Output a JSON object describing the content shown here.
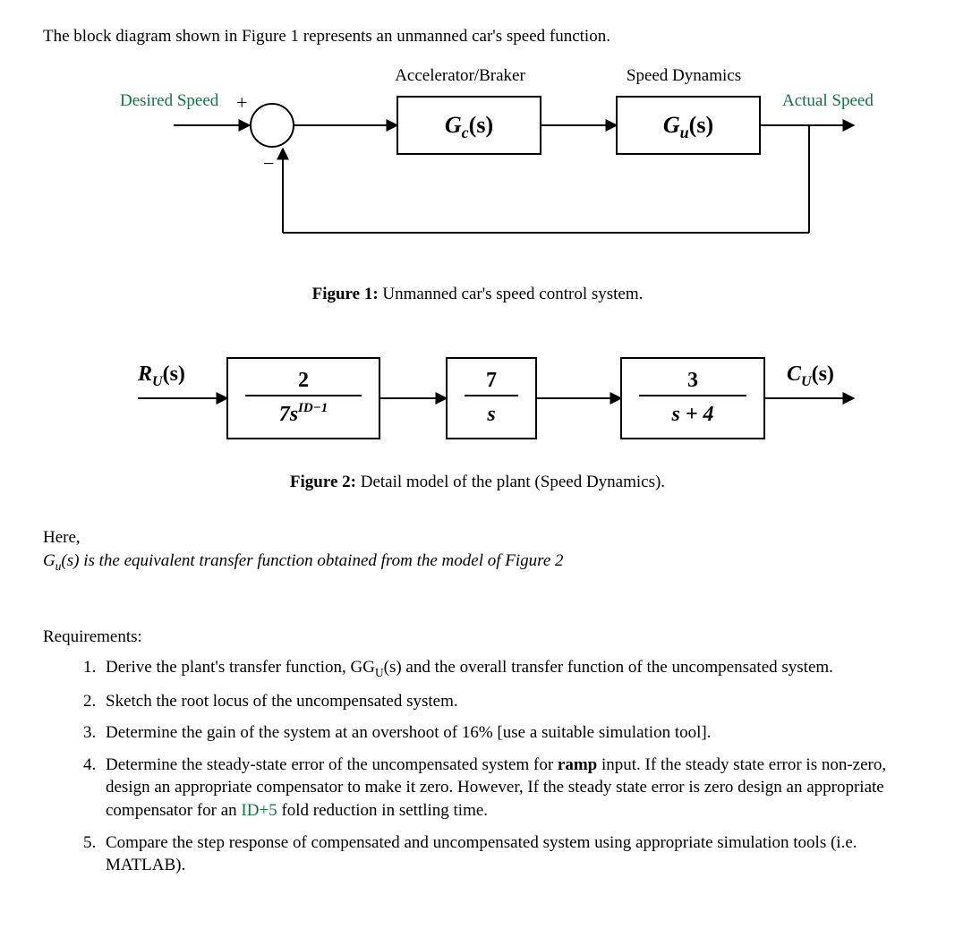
{
  "intro": "The block diagram shown in Figure 1 represents an unmanned car's speed function.",
  "fig1": {
    "labels": {
      "top_left": "Accelerator/Braker",
      "top_right": "Speed Dynamics",
      "input": "Desired Speed",
      "output": "Actual Speed",
      "plus": "+",
      "minus": "−",
      "block1": "G",
      "block1_sub": "c",
      "block1_arg": "(s)",
      "block2": "G",
      "block2_sub": "u",
      "block2_arg": "(s)"
    },
    "caption_bold": "Figure 1:",
    "caption_rest": " Unmanned car's speed control system."
  },
  "fig2": {
    "input_sym": "R",
    "input_sub": "U",
    "input_arg": "(s)",
    "output_sym": "C",
    "output_sub": "U",
    "output_arg": "(s)",
    "block1_num": "2",
    "block1_den_a": "7s",
    "block1_den_sup": "ID−1",
    "block2_num": "7",
    "block2_den": "s",
    "block3_num": "3",
    "block3_den": "s + 4",
    "caption_bold": "Figure 2:",
    "caption_rest": " Detail model of the plant (Speed Dynamics)."
  },
  "here": "Here,",
  "gu_desc_a": "G",
  "gu_desc_sub": "u",
  "gu_desc_b": "(s) is the equivalent transfer function obtained from the model of Figure 2",
  "req_title": "Requirements:",
  "req": [
    {
      "a": "Derive the plant's transfer function, G",
      "sub": "U",
      "b": "(s) and the overall transfer function of the uncompensated system."
    },
    {
      "a": "Sketch the root locus of the uncompensated system."
    },
    {
      "a": "Determine the gain of the system at an overshoot of 16% [use a suitable simulation tool]."
    },
    {
      "a": "Determine the steady-state error of the uncompensated system for ",
      "bold": "ramp",
      "b": " input. If the steady state error is non-zero, design an appropriate compensator to make it zero. However, If the steady state error is zero design an appropriate compensator for an ",
      "grn": "ID+5",
      "c": " fold reduction in settling time."
    },
    {
      "a": "Compare the step response of compensated and uncompensated system using appropriate simulation tools (i.e. MATLAB)."
    }
  ]
}
